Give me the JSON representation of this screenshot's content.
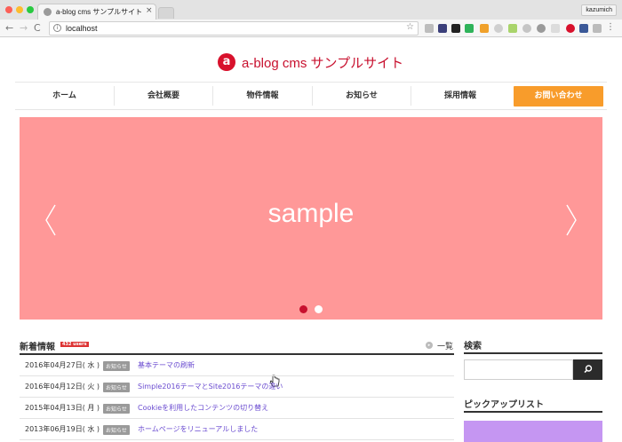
{
  "browser": {
    "tab_title": "a-blog cms サンプルサイト | a-bl",
    "tab_close": "×",
    "profile_name": "kazumich",
    "url": "localhost",
    "back_icon": "←",
    "forward_icon": "→",
    "reload_icon": "C",
    "info_icon": "i",
    "star_icon": "☆",
    "menu_icon": "⋮"
  },
  "site": {
    "title": "a-blog cms サンプルサイト",
    "logo_glyph": "a"
  },
  "nav": {
    "items": [
      "ホーム",
      "会社概要",
      "物件情報",
      "お知らせ",
      "採用情報"
    ],
    "cta": "お問い合わせ"
  },
  "slider": {
    "text": "sample",
    "bg_color": "#ff9898",
    "active_dot_color": "#c8102e",
    "inactive_dot_color": "#ffffff",
    "active_index": 0
  },
  "news": {
    "title": "新着情報",
    "badge": "432 users",
    "more_label": "一覧",
    "more_icon": "▸",
    "rows": [
      {
        "date": "2016年04月27日( 水 )",
        "category": "お知らせ",
        "title": "基本テーマの刷新"
      },
      {
        "date": "2016年04月12日( 火 )",
        "category": "お知らせ",
        "title": "Simple2016テーマとSite2016テーマの違い"
      },
      {
        "date": "2015年04月13日( 月 )",
        "category": "お知らせ",
        "title": "Cookieを利用したコンテンツの切り替え"
      },
      {
        "date": "2013年06月19日( 水 )",
        "category": "お知らせ",
        "title": "ホームページをリニューアルしました"
      }
    ]
  },
  "sidebar": {
    "search_title": "検索",
    "search_placeholder": "",
    "pickup_title": "ピックアップリスト"
  },
  "colors": {
    "brand": "#c8102e",
    "cta": "#f89c2b",
    "link": "#6a4bd0"
  }
}
